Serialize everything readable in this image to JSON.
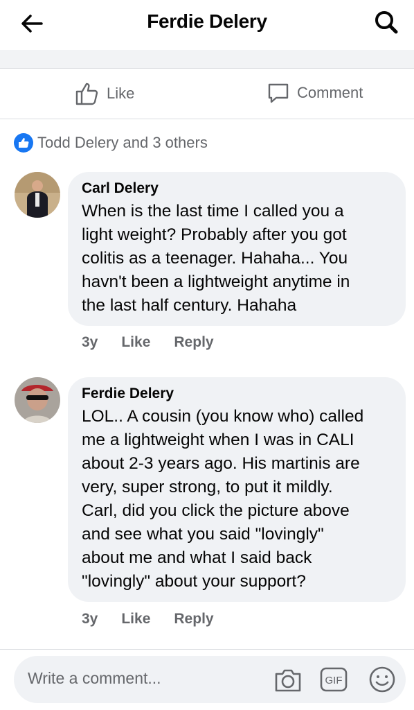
{
  "header": {
    "title": "Ferdie Delery"
  },
  "actions": {
    "like_label": "Like",
    "comment_label": "Comment"
  },
  "reactions": {
    "text": "Todd Delery and 3 others"
  },
  "comments": [
    {
      "author": "Carl Delery",
      "text": "When is the last time I called you a\nlight weight?  Probably   after you got\ncolitis as a teenager.  Hahaha...  You\nhavn't been a lightweight anytime in\nthe last half century.  Hahaha",
      "age": "3y",
      "like": "Like",
      "reply": "Reply"
    },
    {
      "author": "Ferdie Delery",
      "text": "LOL.. A cousin (you know who) called\nme a lightweight when I was in CALI\nabout 2-3 years ago. His martinis are\nvery, super strong, to put it mildly.\nCarl, did you click the picture above\nand see what you said \"lovingly\"\nabout me and what I said back\n\"lovingly\" about your support?",
      "age": "3y",
      "like": "Like",
      "reply": "Reply"
    }
  ],
  "composer": {
    "placeholder": "Write a comment...",
    "gif_label": "GIF"
  },
  "icons": [
    "back-arrow-icon",
    "search-icon",
    "thumbs-up-icon",
    "comment-bubble-icon",
    "like-badge-icon",
    "camera-icon",
    "gif-icon",
    "emoji-icon"
  ],
  "colors": {
    "accent": "#1877f2",
    "bubble": "#f0f2f5",
    "muted": "#65676b"
  }
}
